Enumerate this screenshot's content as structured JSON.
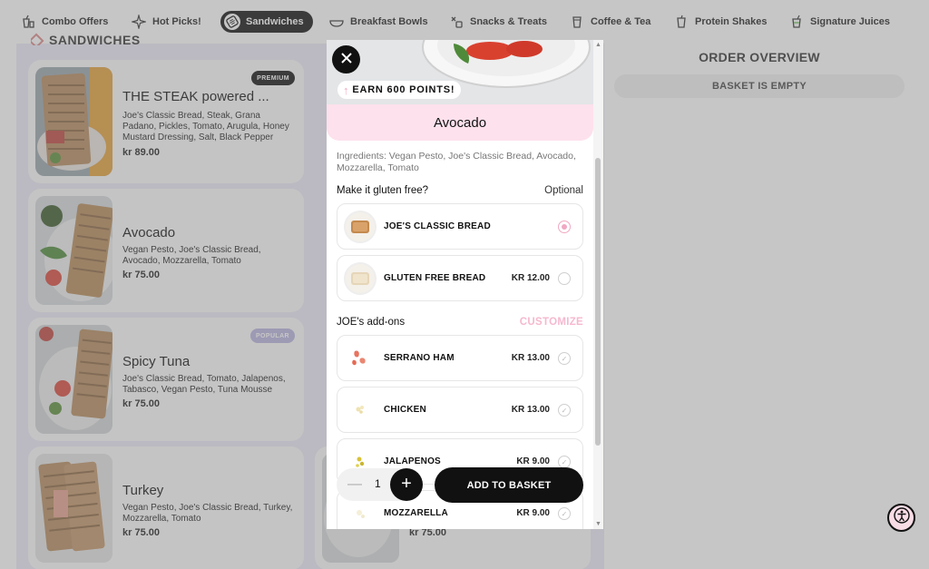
{
  "nav": {
    "items": [
      {
        "label": "Combo Offers",
        "icon": "combo-cup-icon"
      },
      {
        "label": "Hot Picks!",
        "icon": "sparkle-icon"
      },
      {
        "label": "Sandwiches",
        "icon": "sandwich-icon",
        "active": true
      },
      {
        "label": "Breakfast Bowls",
        "icon": "bowl-icon"
      },
      {
        "label": "Snacks & Treats",
        "icon": "snacks-icon"
      },
      {
        "label": "Coffee & Tea",
        "icon": "coffee-cup-icon"
      },
      {
        "label": "Protein Shakes",
        "icon": "shake-icon"
      },
      {
        "label": "Signature Juices",
        "icon": "juice-icon"
      }
    ]
  },
  "section": {
    "title": "SANDWICHES"
  },
  "products": [
    {
      "name": "THE STEAK powered ...",
      "desc": "Joe's Classic Bread, Steak, Grana Padano, Pickles, Tomato, Arugula, Honey Mustard Dressing, Salt, Black Pepper",
      "price": "kr 89.00",
      "badge": "PREMIUM"
    },
    {
      "name": "Avocado",
      "desc": "Vegan Pesto, Joe's Classic Bread, Avocado, Mozzarella, Tomato",
      "price": "kr 75.00"
    },
    {
      "name": "Spicy Tuna",
      "desc": "Joe's Classic Bread, Tomato, Jalapenos, Tabasco, Vegan Pesto, Tuna Mousse",
      "price": "kr 75.00",
      "badge": "POPULAR"
    },
    {
      "name": "Turkey",
      "desc": "Vegan Pesto, Joe's Classic Bread, Turkey, Mozzarella, Tomato",
      "price": "kr 75.00"
    },
    {
      "price": "kr 75.00"
    }
  ],
  "order": {
    "title": "ORDER OVERVIEW",
    "empty": "BASKET IS EMPTY"
  },
  "modal": {
    "points": "EARN 600 POINTS!",
    "title": "Avocado",
    "ingredients": "Ingredients: Vegan Pesto, Joe's Classic Bread, Avocado, Mozzarella, Tomato",
    "gluten": {
      "heading": "Make it gluten free?",
      "aside": "Optional",
      "options": [
        {
          "name": "JOE'S CLASSIC BREAD",
          "price": "",
          "selected": true
        },
        {
          "name": "GLUTEN FREE BREAD",
          "price": "KR 12.00",
          "selected": false
        }
      ]
    },
    "addons": {
      "heading": "JOE's add-ons",
      "aside": "CUSTOMIZE",
      "options": [
        {
          "name": "SERRANO HAM",
          "price": "KR 13.00"
        },
        {
          "name": "CHICKEN",
          "price": "KR 13.00"
        },
        {
          "name": "JALAPENOS",
          "price": "KR 9.00"
        },
        {
          "name": "MOZZARELLA",
          "price": "KR 9.00"
        }
      ]
    },
    "quantity": "1",
    "add_label": "ADD TO BASKET"
  },
  "colors": {
    "accent_pink": "#f0a8c3",
    "title_band": "#fde1ec",
    "grid_bg": "#ecebf8",
    "dark": "#111111"
  }
}
